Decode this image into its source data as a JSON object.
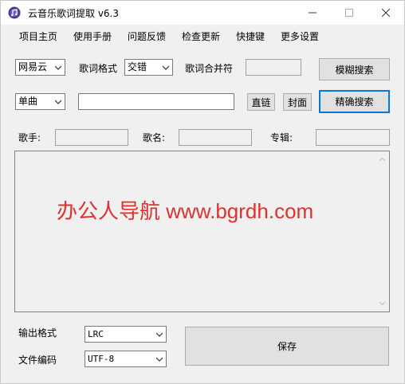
{
  "window": {
    "title": "云音乐歌词提取 v6.3",
    "minimize": "—",
    "maximize": "☐",
    "close": "✕"
  },
  "menu": [
    "项目主页",
    "使用手册",
    "问题反馈",
    "检查更新",
    "快捷键",
    "更多设置"
  ],
  "row1": {
    "source": "网易云",
    "lyric_format_label": "歌词格式",
    "lyric_format": "交错",
    "merge_label": "歌词合并符",
    "merge_value": "",
    "fuzzy_search": "模糊搜索"
  },
  "row2": {
    "mode": "单曲",
    "search_input": "",
    "direct_link": "直链",
    "cover": "封面",
    "exact_search": "精确搜索"
  },
  "row3": {
    "singer_label": "歌手:",
    "singer": "",
    "song_label": "歌名:",
    "song": "",
    "album_label": "专辑:",
    "album": ""
  },
  "output": {
    "text": ""
  },
  "watermark": "办公人导航 www.bgrdh.com",
  "bottom": {
    "output_format_label": "输出格式",
    "output_format": "LRC",
    "encoding_label": "文件编码",
    "encoding": "UTF-8",
    "save": "保存"
  },
  "colors": {
    "accent": "#0078d7",
    "watermark": "#e03030"
  }
}
